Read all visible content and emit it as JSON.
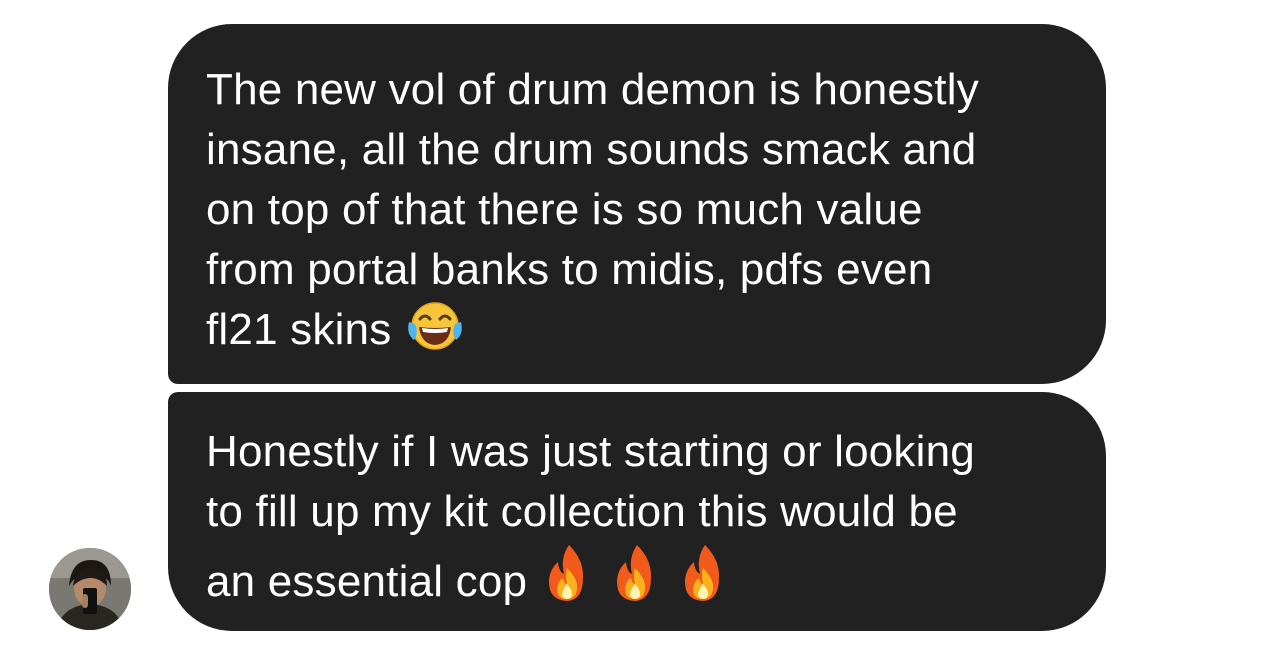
{
  "messages": [
    {
      "text": "The new vol of drum demon is honestly\ninsane, all the drum sounds smack and\non top of that there is so much value\nfrom portal banks to midis, pdfs even\nfl21 skins",
      "emoji": "😂",
      "emoji_icon": "face-with-tears-of-joy-icon"
    },
    {
      "text": "Honestly if I was just starting or looking\nto fill up my kit collection this would be\nan essential cop",
      "emoji": "🔥🔥🔥",
      "emoji_icon": "fire-icon"
    }
  ],
  "colors": {
    "bubble": "#212121",
    "text": "#ffffff",
    "background": "#ffffff"
  }
}
